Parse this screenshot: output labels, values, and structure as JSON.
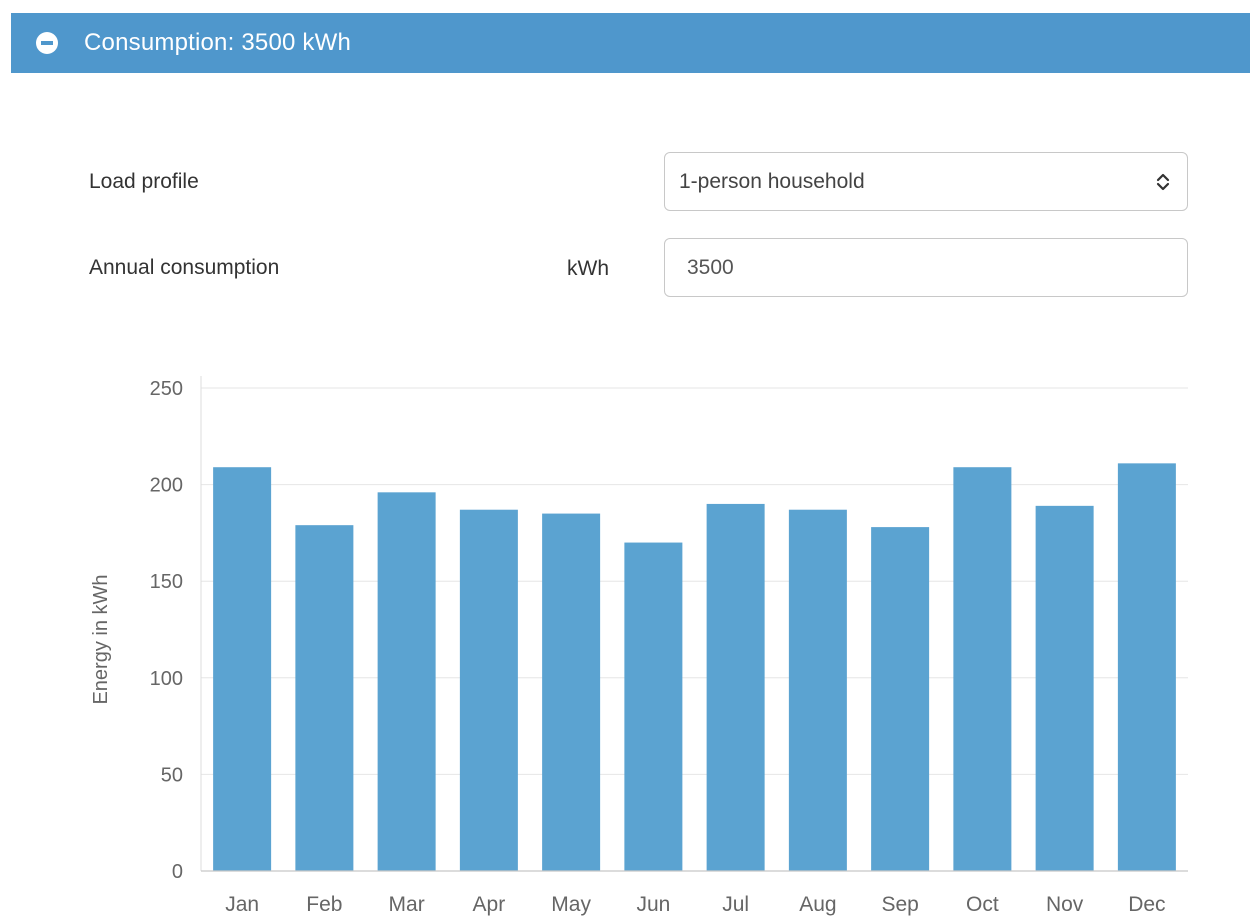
{
  "header": {
    "title": "Consumption: 3500 kWh",
    "icon": "minus-circle-icon",
    "background": "#4f97cc"
  },
  "form": {
    "load_profile": {
      "label": "Load profile",
      "selected": "1-person household"
    },
    "annual_consumption": {
      "label": "Annual consumption",
      "unit": "kWh",
      "value": "3500"
    }
  },
  "chart_data": {
    "type": "bar",
    "categories": [
      "Jan",
      "Feb",
      "Mar",
      "Apr",
      "May",
      "Jun",
      "Jul",
      "Aug",
      "Sep",
      "Oct",
      "Nov",
      "Dec"
    ],
    "values": [
      209,
      179,
      196,
      187,
      185,
      170,
      190,
      187,
      178,
      209,
      189,
      211
    ],
    "ylabel": "Energy in kWh",
    "xlabel": "",
    "ylim": [
      0,
      250
    ],
    "yticks": [
      0,
      50,
      100,
      150,
      200,
      250
    ],
    "grid": true,
    "bar_color": "#5ba3d1"
  }
}
